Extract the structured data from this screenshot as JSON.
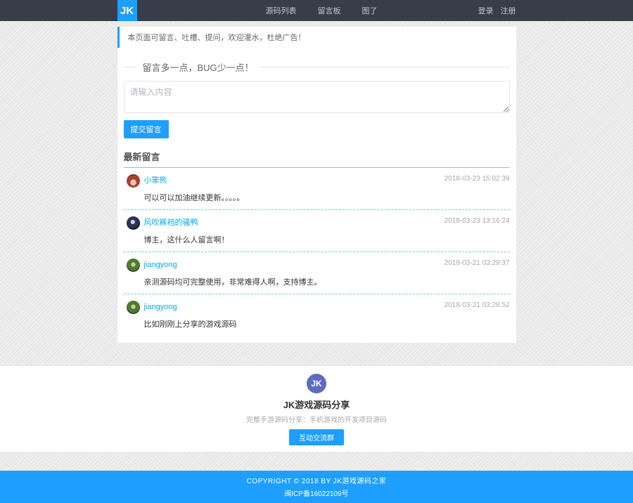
{
  "colors": {
    "header_bg": "#393D49",
    "accent_blue": "#1E9FFF",
    "link_cyan": "#01AAED",
    "footer_badge_indigo": "#5c6bc0"
  },
  "navbar": {
    "logo": "JK",
    "items": [
      {
        "label": "源码列表"
      },
      {
        "label": "留言板"
      },
      {
        "label": "图了"
      }
    ],
    "auth": {
      "login": "登录",
      "register": "注册"
    }
  },
  "notice": "本页面可留言、吐槽、提问，欢迎灌水，杜绝广告！",
  "form": {
    "legend": "留言多一点，BUG少一点！",
    "textarea_placeholder": "请输入内容",
    "submit_label": "提交留言"
  },
  "comments": {
    "title": "最新留言",
    "list": [
      {
        "user": "小笨熊",
        "time": "2018-03-23 15:02:39",
        "text": "可以可以加油继续更新。。。。。",
        "avatar": "girl"
      },
      {
        "user": "风吹裤裆的骚鸭",
        "time": "2018-03-23 13:16:24",
        "text": "博主，这什么人留言啊！",
        "avatar": "dark"
      },
      {
        "user": "jiangyong",
        "time": "2018-03-21 03:29:37",
        "text": "亲测源码均可完整使用，非常难得人啊，支持博主。",
        "avatar": "green"
      },
      {
        "user": "jiangyong",
        "time": "2018-03-21 03:28:52",
        "text": "比如刚刚上分享的游戏源码",
        "avatar": "green"
      }
    ]
  },
  "footer": {
    "logo": "JK",
    "title": "JK游戏源码分享",
    "subtitle": "完整手游源码分享：手机游戏的开发项目源码",
    "button_label": "互动交流群"
  },
  "bottom": {
    "copyright": "COPYRIGHT © 2018 BY JK游戏源码之家",
    "icp": "闽ICP备16022109号"
  }
}
